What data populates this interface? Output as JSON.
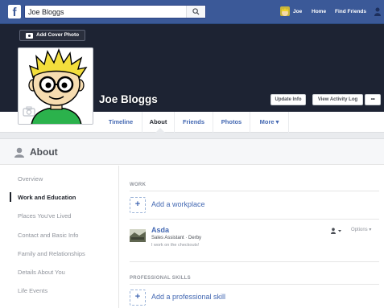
{
  "topbar": {
    "logo_letter": "f",
    "search_value": "Joe Bloggs",
    "nav_user": "Joe",
    "nav_home": "Home",
    "nav_find_friends": "Find Friends"
  },
  "cover": {
    "add_cover_label": "Add Cover Photo",
    "profile_name": "Joe Bloggs",
    "update_info_label": "Update Info",
    "activity_log_label": "View Activity Log",
    "more_dots_label": "•••"
  },
  "tabs": [
    {
      "label": "Timeline"
    },
    {
      "label": "About"
    },
    {
      "label": "Friends"
    },
    {
      "label": "Photos"
    },
    {
      "label": "More ▾"
    }
  ],
  "about": {
    "title": "About",
    "nav": [
      {
        "label": "Overview"
      },
      {
        "label": "Work and Education"
      },
      {
        "label": "Places You've Lived"
      },
      {
        "label": "Contact and Basic Info"
      },
      {
        "label": "Family and Relationships"
      },
      {
        "label": "Details About You"
      },
      {
        "label": "Life Events"
      }
    ],
    "work_title": "WORK",
    "add_workplace": "Add a workplace",
    "job": {
      "company": "Asda",
      "title": "Sales Assistant · Derby",
      "description": "I work on the checkouts!",
      "options_label": "Options ▾"
    },
    "skills_title": "PROFESSIONAL SKILLS",
    "add_skill": "Add a professional skill"
  }
}
